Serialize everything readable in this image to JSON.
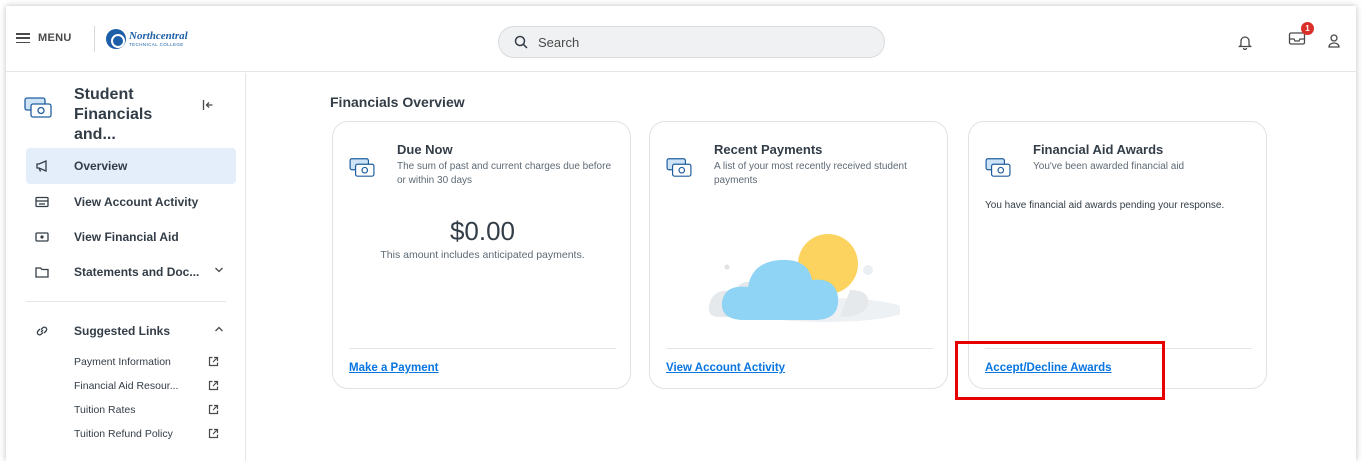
{
  "topbar": {
    "menu_label": "MENU",
    "logo": {
      "line1": "Northcentral",
      "line2": "TECHNICAL COLLEGE"
    },
    "search_placeholder": "Search",
    "notification_count": "1"
  },
  "sidebar": {
    "title": "Student Financials and...",
    "items": [
      {
        "label": "Overview",
        "icon": "megaphone-icon",
        "active": true
      },
      {
        "label": "View Account Activity",
        "icon": "statement-icon",
        "active": false
      },
      {
        "label": "View Financial Aid",
        "icon": "money-icon",
        "active": false
      },
      {
        "label": "Statements and Doc...",
        "icon": "folder-icon",
        "active": false
      }
    ],
    "suggested_links": {
      "label": "Suggested Links",
      "links": [
        {
          "label": "Payment Information"
        },
        {
          "label": "Financial Aid Resour..."
        },
        {
          "label": "Tuition Rates"
        },
        {
          "label": "Tuition Refund Policy"
        }
      ]
    }
  },
  "main": {
    "title": "Financials Overview",
    "cards": [
      {
        "title": "Due Now",
        "subtitle": "The sum of past and current charges due before or within 30 days",
        "amount": "$0.00",
        "amount_note": "This amount includes anticipated payments.",
        "link": "Make a Payment"
      },
      {
        "title": "Recent Payments",
        "subtitle": "A list of your most recently received student payments",
        "link": "View Account Activity"
      },
      {
        "title": "Financial Aid Awards",
        "subtitle": "You've been awarded financial aid",
        "message": "You have financial aid awards pending your response.",
        "link": "Accept/Decline Awards"
      }
    ]
  },
  "colors": {
    "accent": "#0875e1",
    "active_bg": "#e4eefb",
    "highlight": "#e60000",
    "badge": "#d9302a"
  }
}
